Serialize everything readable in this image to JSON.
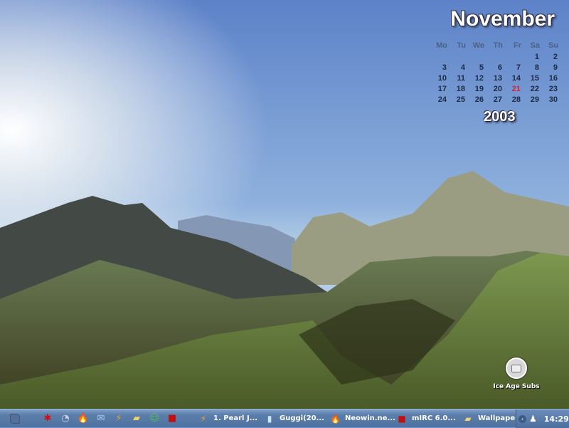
{
  "calendar": {
    "month": "November",
    "year": "2003",
    "days": [
      "Mo",
      "Tu",
      "We",
      "Th",
      "Fr",
      "Sa",
      "Su"
    ],
    "weeks": [
      [
        "",
        "",
        "",
        "",
        "",
        "1",
        "2"
      ],
      [
        "3",
        "4",
        "5",
        "6",
        "7",
        "8",
        "9"
      ],
      [
        "10",
        "11",
        "12",
        "13",
        "14",
        "15",
        "16"
      ],
      [
        "17",
        "18",
        "19",
        "20",
        "21",
        "22",
        "23"
      ],
      [
        "24",
        "25",
        "26",
        "27",
        "28",
        "29",
        "30"
      ]
    ],
    "today": "21",
    "today_color": "#d2223a"
  },
  "desktop_icons": [
    {
      "label": "Ice Age Subs",
      "icon": "folder-icon"
    }
  ],
  "taskbar": {
    "quick_launch": [
      {
        "icon": "splat-icon",
        "glyph": "✱",
        "color": "#d01010"
      },
      {
        "icon": "mouse-icon",
        "glyph": "◔",
        "color": "#c8d0dc"
      },
      {
        "icon": "firefox-icon",
        "glyph": "🔥",
        "color": "#e03010"
      },
      {
        "icon": "outlook-icon",
        "glyph": "✉",
        "color": "#a8d0f0"
      },
      {
        "icon": "winamp-icon",
        "glyph": "⚡",
        "color": "#f0a030"
      },
      {
        "icon": "folder-icon",
        "glyph": "▰",
        "color": "#f0d070"
      },
      {
        "icon": "msn-icon",
        "glyph": "☺",
        "color": "#50c050"
      },
      {
        "icon": "mirc-icon",
        "glyph": "■",
        "color": "#c01010"
      }
    ],
    "windows": [
      {
        "label": "1. Pearl J...",
        "icon": "winamp-icon",
        "glyph": "⚡",
        "color": "#f0a030"
      },
      {
        "label": "Guggi(20...",
        "icon": "document-icon",
        "glyph": "▮",
        "color": "#cfe6ff"
      },
      {
        "label": "Neowin.ne...",
        "icon": "firefox-icon",
        "glyph": "🔥",
        "color": "#e03010"
      },
      {
        "label": "mIRC 6.0...",
        "icon": "mirc-icon",
        "glyph": "■",
        "color": "#c01010"
      },
      {
        "label": "Wallpaper",
        "icon": "folder-icon",
        "glyph": "▰",
        "color": "#f0d070"
      }
    ],
    "clock": "14:29"
  }
}
